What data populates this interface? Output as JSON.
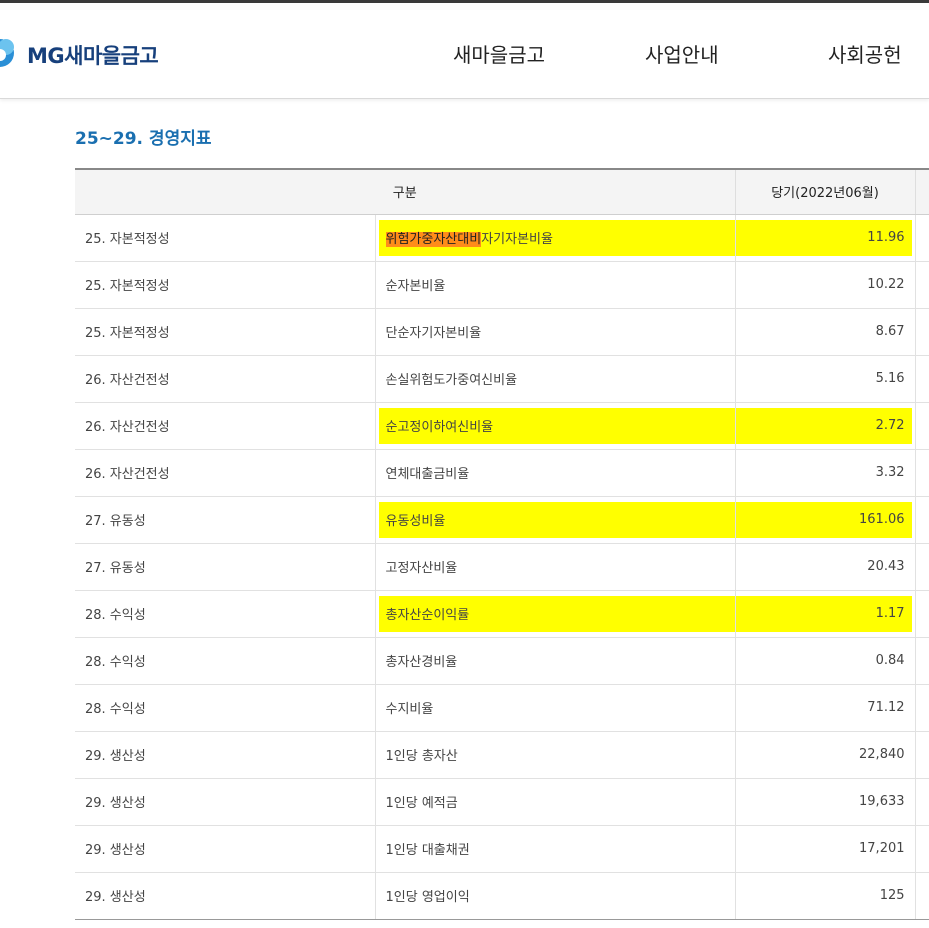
{
  "header": {
    "logo_text": "MG새마을금고",
    "logo_icon": "cloud-logo-icon",
    "nav": [
      "새마을금고",
      "사업안내",
      "사회공헌"
    ]
  },
  "section_title": "25~29. 경영지표",
  "table": {
    "headers": [
      "구분",
      "당기(2022년06월)"
    ],
    "rows": [
      {
        "category": "25. 자본적정성",
        "indicator_part1": "위험가중자산대비",
        "indicator_part2": "자기자본비율",
        "value": "11.96",
        "highlight": true
      },
      {
        "category": "25. 자본적정성",
        "indicator_part1": "",
        "indicator_part2": "순자본비율",
        "value": "10.22",
        "highlight": false
      },
      {
        "category": "25. 자본적정성",
        "indicator_part1": "",
        "indicator_part2": "단순자기자본비율",
        "value": "8.67",
        "highlight": false
      },
      {
        "category": "26. 자산건전성",
        "indicator_part1": "",
        "indicator_part2": "손실위험도가중여신비율",
        "value": "5.16",
        "highlight": false
      },
      {
        "category": "26. 자산건전성",
        "indicator_part1": "",
        "indicator_part2": "순고정이하여신비율",
        "value": "2.72",
        "highlight": true
      },
      {
        "category": "26. 자산건전성",
        "indicator_part1": "",
        "indicator_part2": "연체대출금비율",
        "value": "3.32",
        "highlight": false
      },
      {
        "category": "27. 유동성",
        "indicator_part1": "",
        "indicator_part2": "유동성비율",
        "value": "161.06",
        "highlight": true
      },
      {
        "category": "27. 유동성",
        "indicator_part1": "",
        "indicator_part2": "고정자산비율",
        "value": "20.43",
        "highlight": false
      },
      {
        "category": "28. 수익성",
        "indicator_part1": "",
        "indicator_part2": "총자산순이익률",
        "value": "1.17",
        "highlight": true
      },
      {
        "category": "28. 수익성",
        "indicator_part1": "",
        "indicator_part2": "총자산경비율",
        "value": "0.84",
        "highlight": false
      },
      {
        "category": "28. 수익성",
        "indicator_part1": "",
        "indicator_part2": "수지비율",
        "value": "71.12",
        "highlight": false
      },
      {
        "category": "29. 생산성",
        "indicator_part1": "",
        "indicator_part2": "1인당 총자산",
        "value": "22,840",
        "highlight": false
      },
      {
        "category": "29. 생산성",
        "indicator_part1": "",
        "indicator_part2": "1인당 예적금",
        "value": "19,633",
        "highlight": false
      },
      {
        "category": "29. 생산성",
        "indicator_part1": "",
        "indicator_part2": "1인당 대출채권",
        "value": "17,201",
        "highlight": false
      },
      {
        "category": "29. 생산성",
        "indicator_part1": "",
        "indicator_part2": "1인당 영업이익",
        "value": "125",
        "highlight": false
      }
    ]
  },
  "colors": {
    "highlight": "#ffff00",
    "selection": "#ff8c1a",
    "title": "#1a6fb0",
    "logo": "#17407c"
  }
}
